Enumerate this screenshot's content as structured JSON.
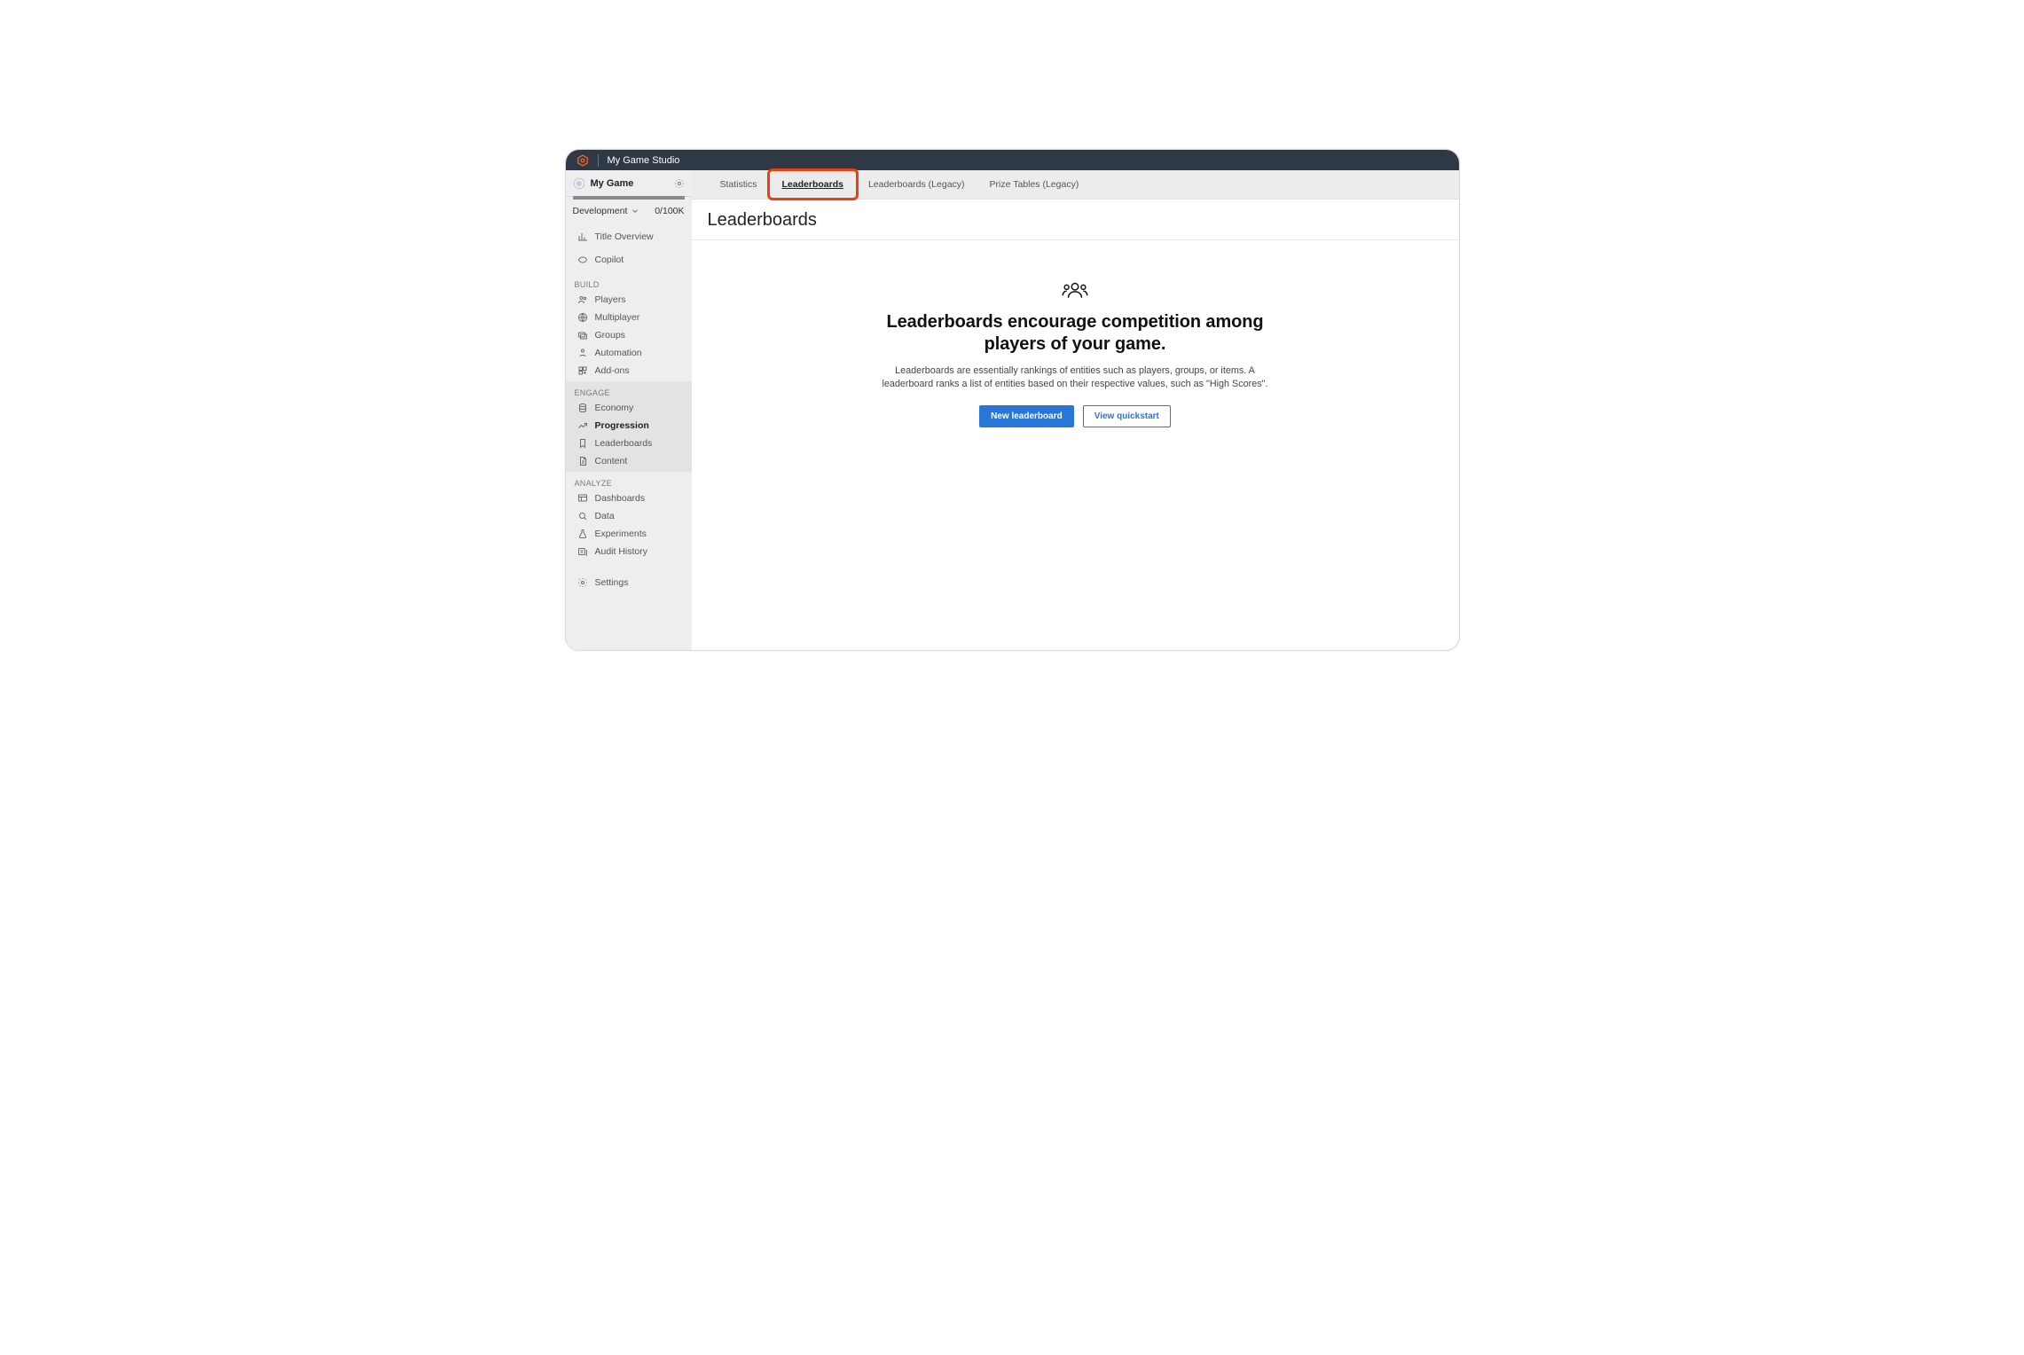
{
  "topbar": {
    "studio_name": "My Game Studio"
  },
  "sidebar": {
    "game_name": "My Game",
    "environment": "Development",
    "usage_count": "0/100K",
    "overview": {
      "label": "Title Overview"
    },
    "copilot": {
      "label": "Copilot"
    },
    "sections": {
      "build": {
        "label": "BUILD",
        "items": [
          {
            "id": "players",
            "label": "Players"
          },
          {
            "id": "multiplayer",
            "label": "Multiplayer"
          },
          {
            "id": "groups",
            "label": "Groups"
          },
          {
            "id": "automation",
            "label": "Automation"
          },
          {
            "id": "addons",
            "label": "Add-ons"
          }
        ]
      },
      "engage": {
        "label": "ENGAGE",
        "items": [
          {
            "id": "economy",
            "label": "Economy"
          },
          {
            "id": "progression",
            "label": "Progression",
            "active": true
          },
          {
            "id": "leaderboards",
            "label": "Leaderboards"
          },
          {
            "id": "content",
            "label": "Content"
          }
        ]
      },
      "analyze": {
        "label": "ANALYZE",
        "items": [
          {
            "id": "dashboards",
            "label": "Dashboards"
          },
          {
            "id": "data",
            "label": "Data"
          },
          {
            "id": "experiments",
            "label": "Experiments"
          },
          {
            "id": "audit",
            "label": "Audit History"
          }
        ]
      }
    },
    "settings": {
      "label": "Settings"
    }
  },
  "tabs": [
    {
      "id": "statistics",
      "label": "Statistics"
    },
    {
      "id": "leaderboards",
      "label": "Leaderboards",
      "active": true,
      "highlighted": true
    },
    {
      "id": "lb_legacy",
      "label": "Leaderboards (Legacy)"
    },
    {
      "id": "pt_legacy",
      "label": "Prize Tables (Legacy)"
    }
  ],
  "page": {
    "title": "Leaderboards",
    "empty": {
      "headline": "Leaderboards encourage competition among players of your game.",
      "description": "Leaderboards are essentially rankings of entities such as players, groups, or items. A leaderboard ranks a list of entities based on their respective values, such as \"High Scores\".",
      "primary_button": "New leaderboard",
      "secondary_button": "View quickstart"
    }
  }
}
